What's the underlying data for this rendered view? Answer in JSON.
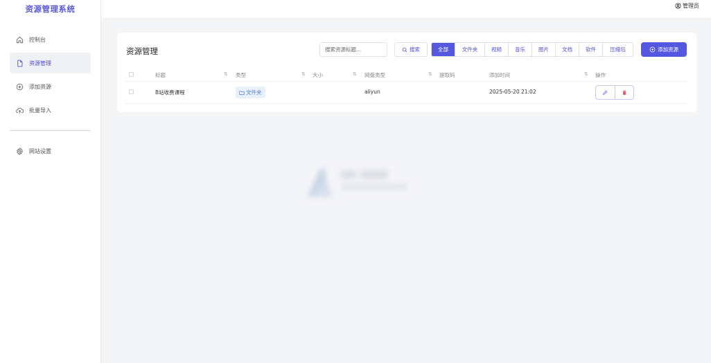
{
  "app": {
    "title": "资源管理系统"
  },
  "sidebar": {
    "items": [
      {
        "label": "控制台",
        "icon": "home-icon"
      },
      {
        "label": "资源管理",
        "icon": "document-icon",
        "active": true
      },
      {
        "label": "添加资源",
        "icon": "plus-circle-icon"
      },
      {
        "label": "批量导入",
        "icon": "cloud-upload-icon"
      },
      {
        "label": "网站设置",
        "icon": "gear-icon"
      }
    ]
  },
  "header": {
    "user": "管理员"
  },
  "card": {
    "title": "资源管理",
    "search": {
      "placeholder": "搜索资源标题...",
      "button": "搜索"
    },
    "filters": [
      {
        "label": "全部",
        "active": true
      },
      {
        "label": "文件夹"
      },
      {
        "label": "视频"
      },
      {
        "label": "音乐"
      },
      {
        "label": "图片"
      },
      {
        "label": "文档"
      },
      {
        "label": "软件"
      },
      {
        "label": "压缩包"
      }
    ],
    "add_button": "添加资源"
  },
  "table": {
    "columns": [
      "标题",
      "类型",
      "大小",
      "网盘类型",
      "提取码",
      "添加时间",
      "操作"
    ],
    "rows": [
      {
        "title": "B站收费课程",
        "type": "文件夹",
        "size": "",
        "disk": "aliyun",
        "code": "",
        "time": "2025-05-20 21:02"
      }
    ]
  },
  "colors": {
    "accent": "#5457e0",
    "brand": "#5b5bd6",
    "danger": "#e8546a"
  }
}
